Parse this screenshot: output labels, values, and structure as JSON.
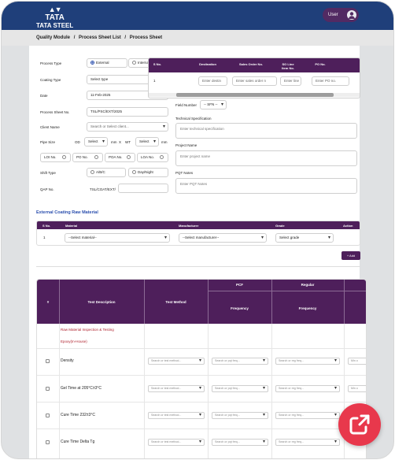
{
  "header": {
    "logo_symbol": "▲▼",
    "logo_top": "TATA",
    "logo_bottom": "TATA STEEL",
    "user_label": "User"
  },
  "breadcrumb": [
    "Quality Module",
    "/",
    "Process Sheet List",
    "/",
    "Process Sheet"
  ],
  "form": {
    "process_type_label": "Process Type",
    "external": "External",
    "internal": "Internal",
    "coating_type_label": "Coating Type",
    "coating_type_value": "Select type",
    "date_label": "Date",
    "date_value": "11-Feb-2025",
    "process_sheet_no_label": "Process Sheet No.",
    "process_sheet_no_value": "TSL/PSC/EXT/2025",
    "client_name_label": "Client Name",
    "client_placeholder": "Search or Select client...",
    "pipe_size_label": "Pipe Size",
    "od_label": "OD",
    "select1": "Select",
    "mm1": "mm",
    "x": "X",
    "wt_label": "WT",
    "select2": "Select",
    "mm2": "mm",
    "loi": "LOI No.",
    "po": "PO No.",
    "poa": "POA No.",
    "loa": "LOA No.",
    "shift_type_label": "Shift Type",
    "ab_c": "A/B/C",
    "day_night": "Day/Night",
    "qap_label": "QAP No.",
    "qap_prefix": "TSL/COAT/EXT/"
  },
  "so_table": {
    "headers": [
      "S No.",
      "Destination",
      "Sales Order No.",
      "SO Line Item No.",
      "PO No."
    ],
    "row": {
      "sno": "1",
      "destination_ph": "Enter destin",
      "sales_order_ph": "Enter sales order n",
      "line_item_ph": "Enter line",
      "po_ph": "Enter PO no."
    }
  },
  "right": {
    "field_number_label": "Field Number",
    "field_number_value": "-- SFN --",
    "tech_spec_label": "Technical Specification",
    "tech_spec_ph": "Enter technical specification",
    "project_name_label": "Project Name",
    "project_name_ph": "Enter project name",
    "pqt_label": "PQT Notes",
    "pqt_ph": "Enter PQT Notes"
  },
  "raw_material": {
    "title": "External Coating Raw Material",
    "headers": [
      "S No.",
      "Material",
      "Manufacturer",
      "Grade",
      "Action"
    ],
    "row": {
      "sno": "1",
      "material": "--Select material--",
      "manufacturer": "--Select manufacturer--",
      "grade": "Select grade"
    },
    "add_label": "+ Add"
  },
  "test_table": {
    "headers": {
      "no": "#",
      "desc": "Test Description",
      "method": "Test Method",
      "pcf": "PCF",
      "pcf_freq": "Frequency",
      "regular": "Regular",
      "reg_freq": "Frequency"
    },
    "section_title": "Raw Material Inspection & Testing",
    "sub_title": "Epoxy(In-House)",
    "rows": [
      "Density",
      "Gel Time at 205°C±3°C",
      "Cure Time 232±3°C",
      "Cure Time Delta Tg"
    ],
    "method_ph": "Search or test method...",
    "pcf_ph": "Search or pqt freq...",
    "reg_ph": "Search or reg freq...",
    "min_ph": "Min o"
  },
  "colors": {
    "brand": "#1f3f7a",
    "accent": "#4e1f5b",
    "fab": "#e8384c"
  },
  "icons": {
    "user": "user-icon",
    "calendar": "calendar-icon",
    "open": "open-external-icon"
  }
}
